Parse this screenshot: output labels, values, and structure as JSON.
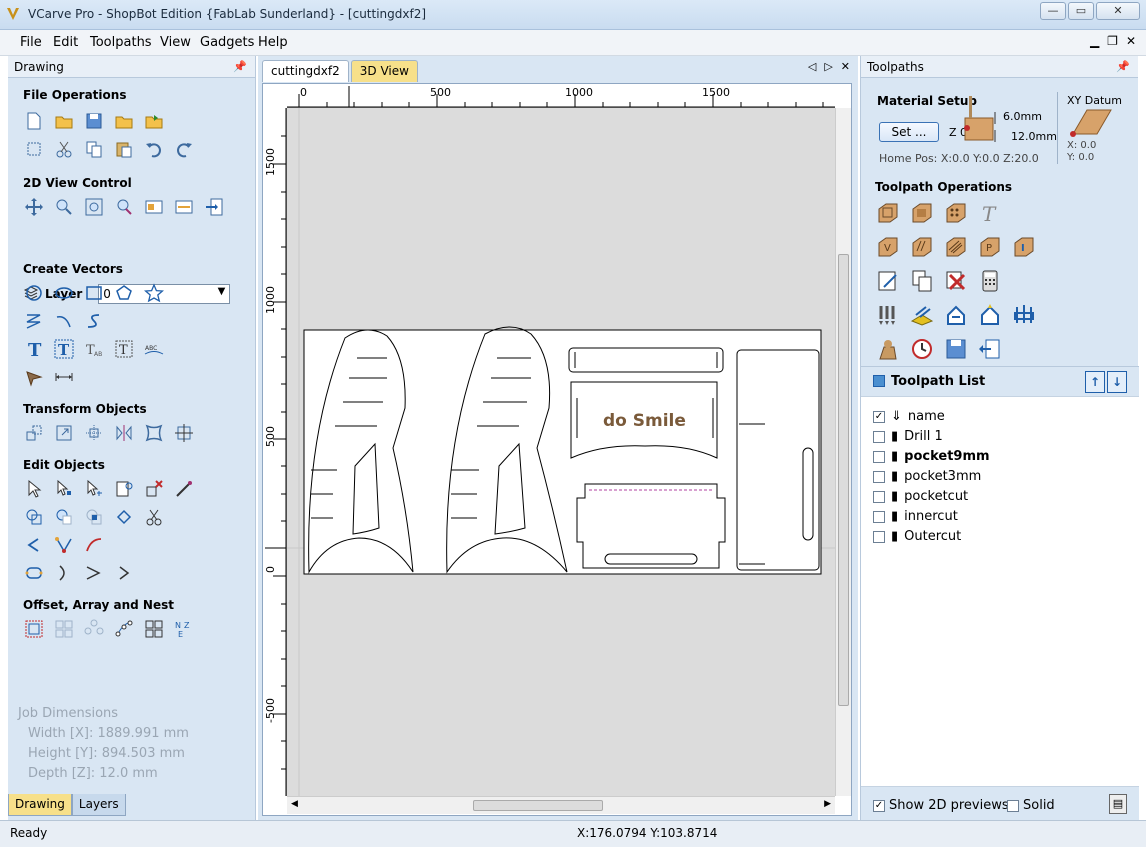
{
  "window": {
    "title": "VCarve Pro - ShopBot Edition {FabLab Sunderland} - [cuttingdxf2]"
  },
  "menu": [
    "File",
    "Edit",
    "Toolpaths",
    "View",
    "Gadgets",
    "Help"
  ],
  "left_panel": {
    "title": "Drawing",
    "sections": {
      "file_ops": "File Operations",
      "view_ctrl": "2D View Control",
      "create_vectors": "Create Vectors",
      "transform": "Transform Objects",
      "edit": "Edit Objects",
      "offset": "Offset, Array and Nest"
    },
    "layer_label": "Layer",
    "layer_value": "0",
    "job": {
      "title": "Job Dimensions",
      "width": "Width  [X]: 1889.991 mm",
      "height": "Height [Y]: 894.503 mm",
      "depth": "Depth  [Z]: 12.0 mm"
    },
    "tabs": [
      "Drawing",
      "Layers"
    ]
  },
  "center": {
    "tabs": [
      "cuttingdxf2",
      "3D View"
    ],
    "ruler_x": [
      "0",
      "500",
      "1000",
      "1500"
    ],
    "ruler_y": [
      "1500",
      "1000",
      "500",
      "0",
      "-500"
    ],
    "canvas_text": "do Smile"
  },
  "right_panel": {
    "title": "Toolpaths",
    "material_setup": "Material Setup",
    "set_button": "Set ...",
    "z_label": "Z 0",
    "top_thickness": "6.0mm",
    "material_thickness": "12.0mm",
    "home_pos": "Home Pos:  X:0.0 Y:0.0 Z:20.0",
    "xy_datum": "XY Datum",
    "datum_x": "X: 0.0",
    "datum_y": "Y: 0.0",
    "toolpath_ops": "Toolpath Operations",
    "list_title": "Toolpath List",
    "toolpaths": [
      {
        "name": "name",
        "checked": true,
        "bold": false
      },
      {
        "name": "Drill 1",
        "checked": false,
        "bold": false
      },
      {
        "name": "pocket9mm",
        "checked": false,
        "bold": true
      },
      {
        "name": "pocket3mm",
        "checked": false,
        "bold": false
      },
      {
        "name": "pocketcut",
        "checked": false,
        "bold": false
      },
      {
        "name": "innercut",
        "checked": false,
        "bold": false
      },
      {
        "name": "Outercut",
        "checked": false,
        "bold": false
      }
    ],
    "show_previews": "Show 2D previews",
    "solid": "Solid"
  },
  "status": {
    "left": "Ready",
    "coords": "X:176.0794 Y:103.8714"
  }
}
